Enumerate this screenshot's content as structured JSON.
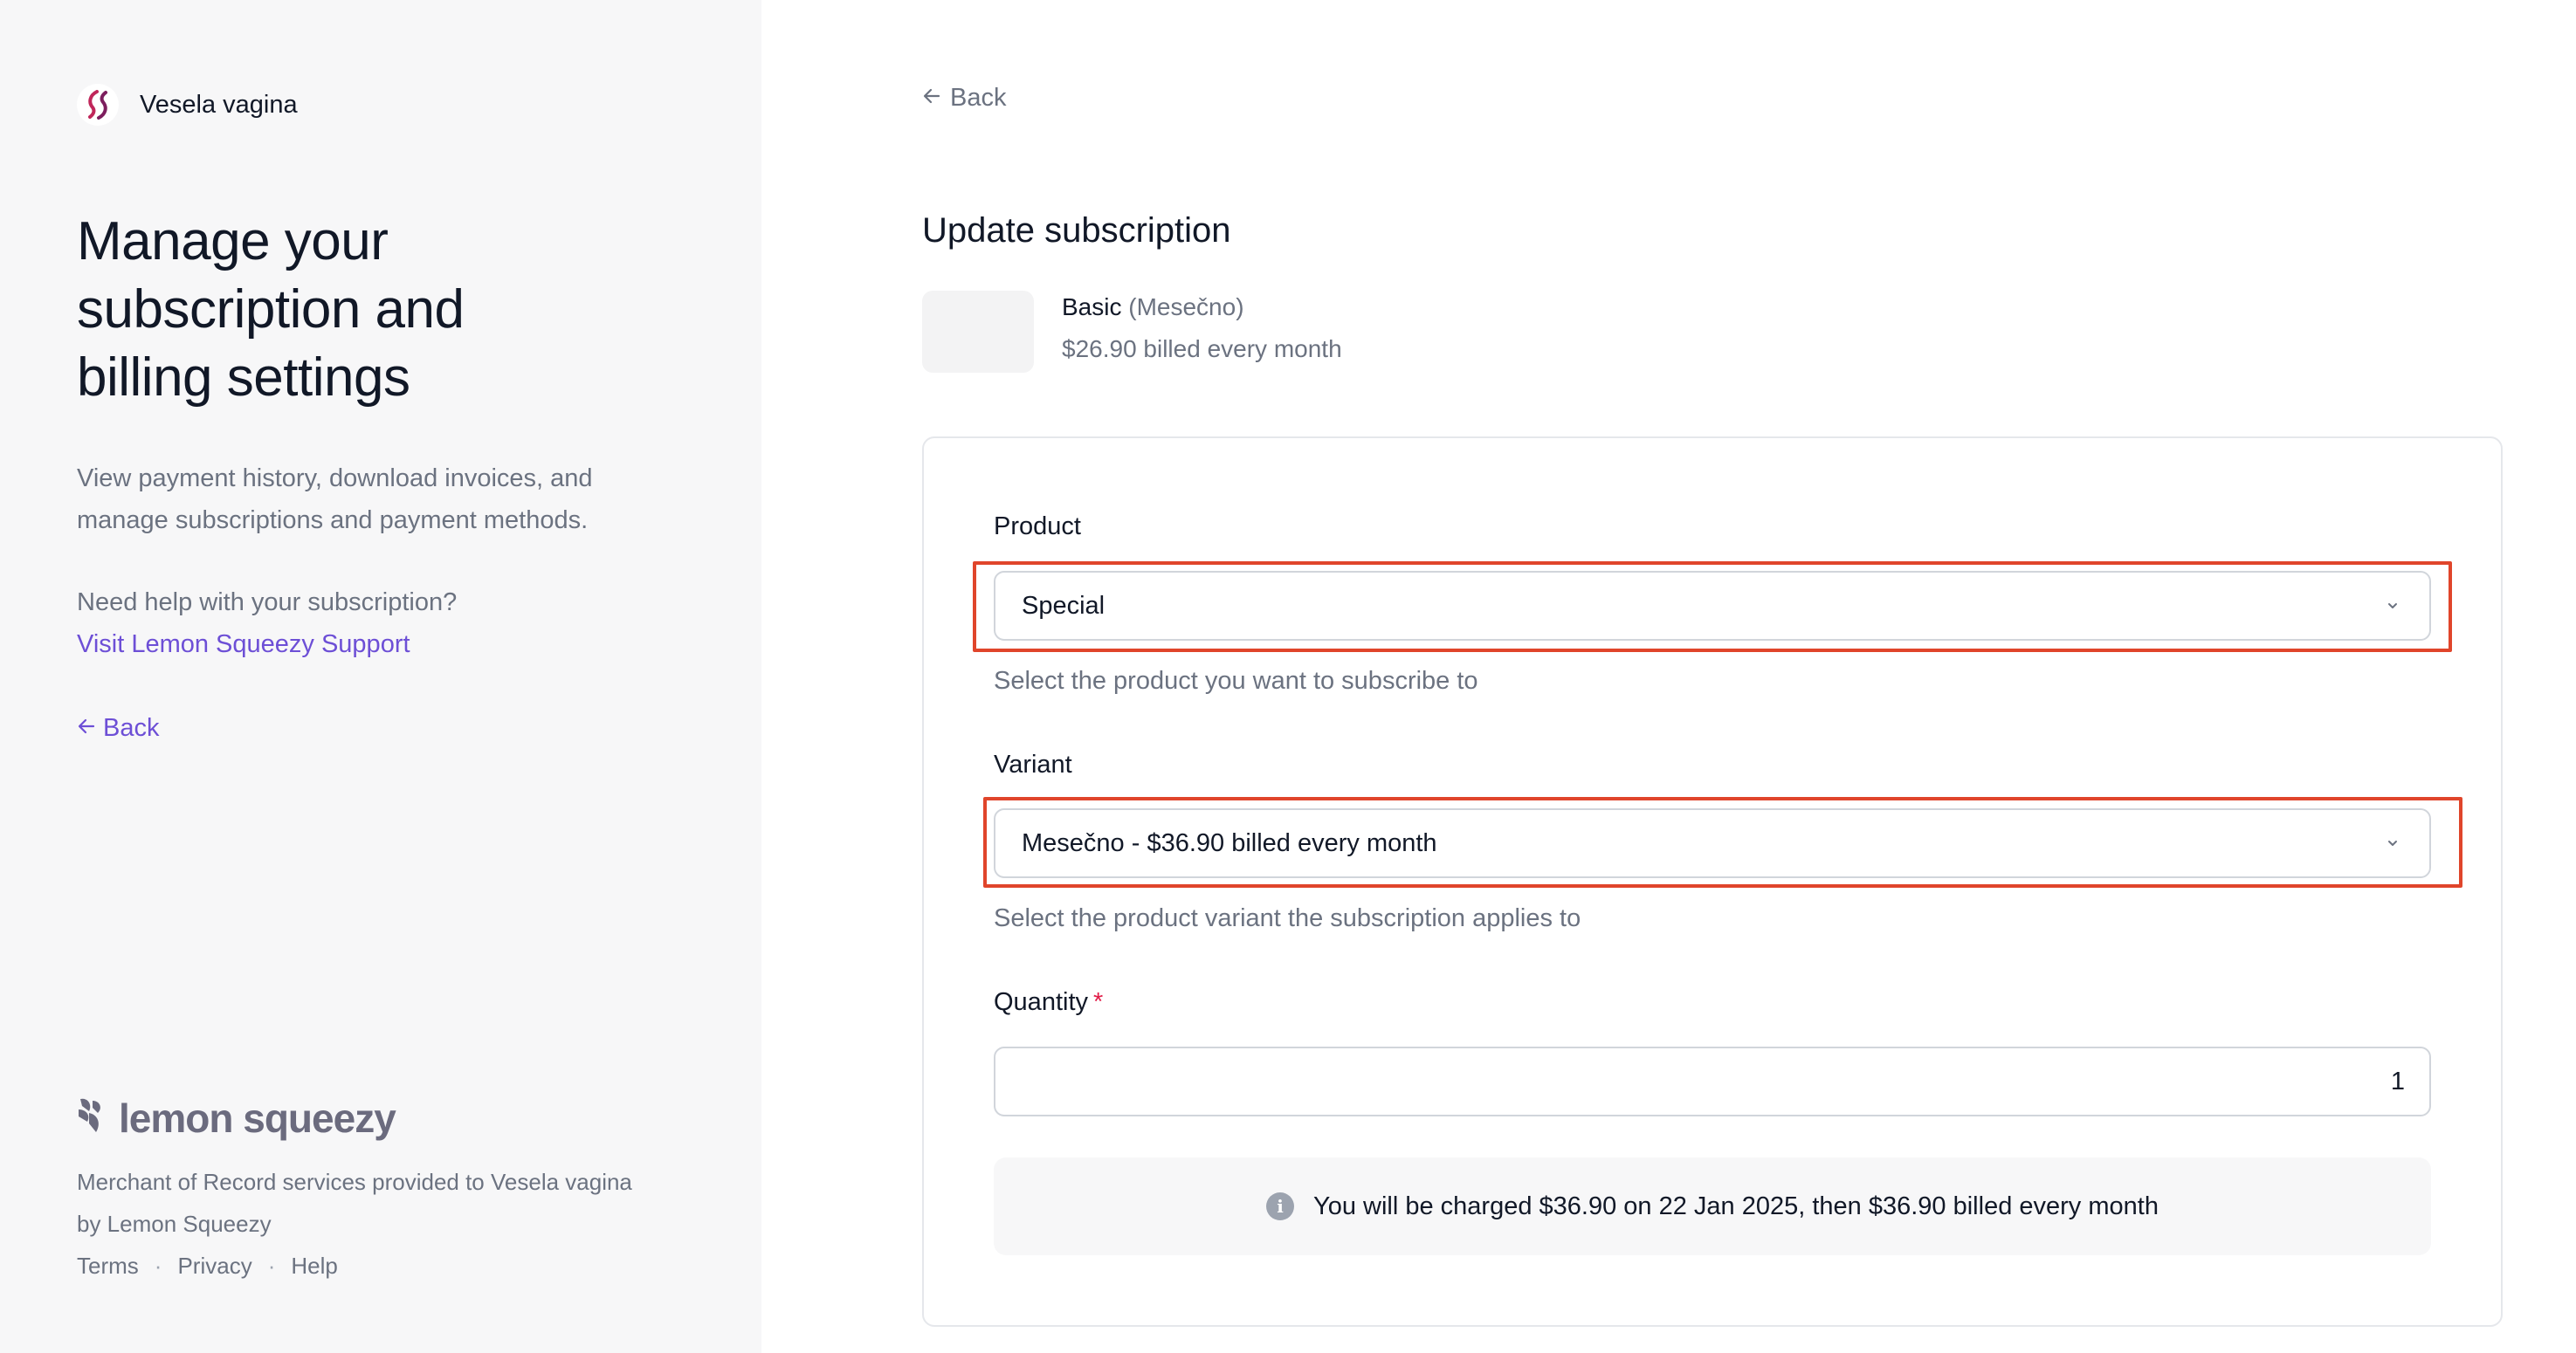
{
  "store": {
    "name": "Vesela vagina",
    "logo_icon": "store-logo-icon"
  },
  "hero": {
    "title": "Manage your subscription and billing settings",
    "description": "View payment history, download invoices, and manage subscriptions and payment methods.",
    "help_question": "Need help with your subscription?",
    "help_link": "Visit Lemon Squeezy Support",
    "back_label": "Back"
  },
  "footer": {
    "brand": "lemon squeezy",
    "merchant_text": "Merchant of Record services provided to Vesela vagina by Lemon Squeezy",
    "links": {
      "terms": "Terms",
      "privacy": "Privacy",
      "help": "Help"
    },
    "separator": "·"
  },
  "main": {
    "back_label": "Back",
    "title": "Update subscription",
    "current_plan": {
      "name": "Basic",
      "variant": "(Mesečno)",
      "price": "$26.90 billed every month"
    },
    "form": {
      "product": {
        "label": "Product",
        "value": "Special",
        "hint": "Select the product you want to subscribe to"
      },
      "variant": {
        "label": "Variant",
        "value": "Mesečno - $36.90 billed every month",
        "hint": "Select the product variant the subscription applies to"
      },
      "quantity": {
        "label": "Quantity",
        "required_mark": "*",
        "value": "1"
      },
      "notice": "You will be charged $36.90 on 22 Jan 2025, then $36.90 billed every month"
    }
  },
  "colors": {
    "accent": "#6d4fd6",
    "highlight": "#e0452b",
    "required": "#e11d48"
  }
}
